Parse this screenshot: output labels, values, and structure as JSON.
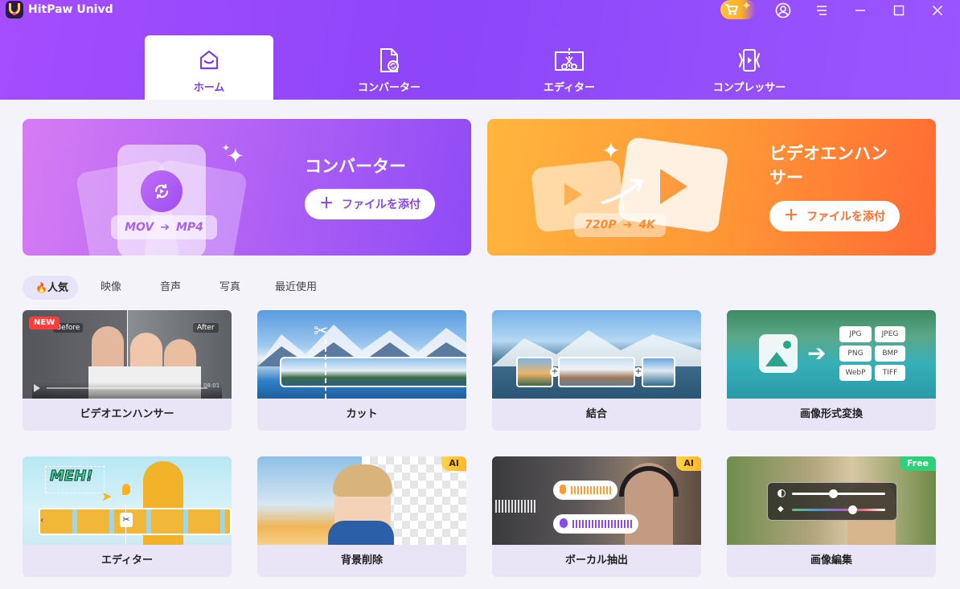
{
  "app": {
    "name": "HitPaw Univd"
  },
  "nav": {
    "tabs": [
      {
        "label": "ホーム",
        "icon": "home-icon"
      },
      {
        "label": "コンバーター",
        "icon": "convert-file-icon"
      },
      {
        "label": "エディター",
        "icon": "editor-cut-icon"
      },
      {
        "label": "コンプレッサー",
        "icon": "compress-icon"
      }
    ]
  },
  "banners": {
    "converter": {
      "title": "コンバーター",
      "button": "ファイルを添付",
      "from": "MOV",
      "to": "MP4"
    },
    "enhancer": {
      "title_line1": "ビデオエンハン",
      "title_line2": "サー",
      "button": "ファイルを添付",
      "from": "720P",
      "to": "4K"
    }
  },
  "categories": [
    {
      "label": "人気",
      "icon": "fire-icon"
    },
    {
      "label": "映像"
    },
    {
      "label": "音声"
    },
    {
      "label": "写真"
    },
    {
      "label": "最近使用"
    }
  ],
  "tools": [
    {
      "label": "ビデオエンハンサー",
      "badge": "NEW",
      "before": "Before",
      "after": "After",
      "time": "08:01"
    },
    {
      "label": "カット"
    },
    {
      "label": "結合"
    },
    {
      "label": "画像形式変換",
      "formats": [
        "JPG",
        "JPEG",
        "PNG",
        "BMP",
        "WebP",
        "TIFF"
      ]
    },
    {
      "label": "エディター",
      "sticker": "MEH!"
    },
    {
      "label": "背景削除",
      "badge": "AI"
    },
    {
      "label": "ボーカル抽出",
      "badge": "AI"
    },
    {
      "label": "画像編集",
      "badge": "Free"
    }
  ],
  "colors": {
    "brand": "#8d46f8",
    "accent_orange": "#ff7a32",
    "ai_badge": "#ffc83a",
    "free_badge": "#2fd07a"
  }
}
